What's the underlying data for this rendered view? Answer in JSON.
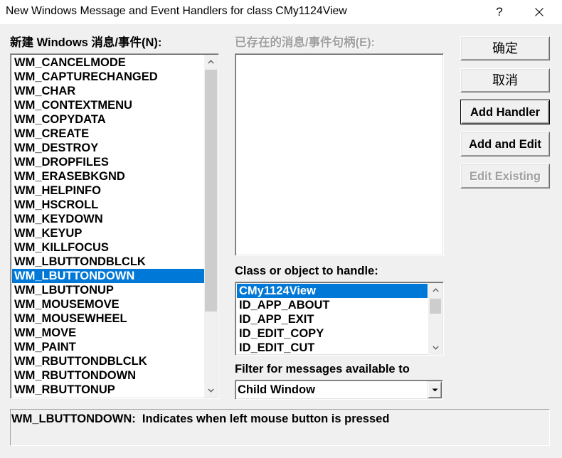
{
  "colors": {
    "selection": "#0078d7",
    "dialog_bg": "#f0f0f0",
    "disabled_text": "#a0a0a0"
  },
  "window": {
    "title": "New Windows Message and Event Handlers for class CMy1124View",
    "help_label": "?",
    "close_icon": "close-icon"
  },
  "new_messages": {
    "label": "新建 Windows 消息/事件(N):",
    "selected_index": 15,
    "scroll_position": 0,
    "scroll_up_icon": "chevron-up-icon",
    "scroll_down_icon": "chevron-down-icon",
    "items": [
      "WM_CANCELMODE",
      "WM_CAPTURECHANGED",
      "WM_CHAR",
      "WM_CONTEXTMENU",
      "WM_COPYDATA",
      "WM_CREATE",
      "WM_DESTROY",
      "WM_DROPFILES",
      "WM_ERASEBKGND",
      "WM_HELPINFO",
      "WM_HSCROLL",
      "WM_KEYDOWN",
      "WM_KEYUP",
      "WM_KILLFOCUS",
      "WM_LBUTTONDBLCLK",
      "WM_LBUTTONDOWN",
      "WM_LBUTTONUP",
      "WM_MOUSEMOVE",
      "WM_MOUSEWHEEL",
      "WM_MOVE",
      "WM_PAINT",
      "WM_RBUTTONDBLCLK",
      "WM_RBUTTONDOWN",
      "WM_RBUTTONUP"
    ]
  },
  "existing_handlers": {
    "label": "已存在的消息/事件句柄(E):",
    "enabled": false,
    "items": []
  },
  "class_or_object": {
    "label": "Class or object to handle:",
    "selected_index": 0,
    "scroll_position": 0,
    "items": [
      "CMy1124View",
      "ID_APP_ABOUT",
      "ID_APP_EXIT",
      "ID_EDIT_COPY",
      "ID_EDIT_CUT"
    ]
  },
  "filter": {
    "label": "Filter for messages available to",
    "value": "Child Window",
    "dropdown_icon": "dropdown-arrow-icon"
  },
  "buttons": {
    "ok": {
      "label": "确定",
      "enabled": true,
      "is_default": false
    },
    "cancel": {
      "label": "取消",
      "enabled": true,
      "is_default": false
    },
    "add_handler": {
      "label": "Add Handler",
      "enabled": true,
      "is_default": true
    },
    "add_and_edit": {
      "label": "Add and Edit",
      "enabled": true,
      "is_default": false
    },
    "edit_existing": {
      "label": "Edit Existing",
      "enabled": false,
      "is_default": false
    }
  },
  "description": {
    "text": "WM_LBUTTONDOWN:  Indicates when left mouse button is pressed"
  }
}
